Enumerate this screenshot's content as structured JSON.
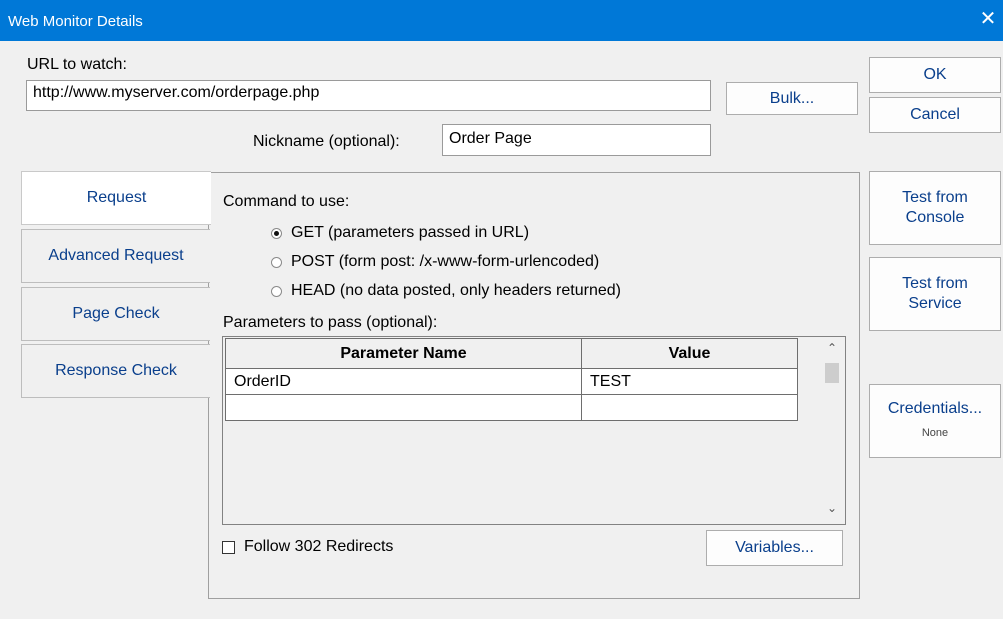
{
  "window": {
    "title": "Web Monitor Details",
    "close_glyph": "✕"
  },
  "url": {
    "label": "URL to watch:",
    "value": "http://www.myserver.com/orderpage.php",
    "bulk_button": "Bulk..."
  },
  "nickname": {
    "label": "Nickname (optional):",
    "value": "Order Page"
  },
  "dialog_buttons": {
    "ok": "OK",
    "cancel": "Cancel"
  },
  "tabs": [
    {
      "label": "Request",
      "active": true
    },
    {
      "label": "Advanced Request",
      "active": false
    },
    {
      "label": "Page Check",
      "active": false
    },
    {
      "label": "Response Check",
      "active": false
    }
  ],
  "request": {
    "command_label": "Command to use:",
    "options": [
      {
        "label": "GET (parameters passed in URL)",
        "selected": true
      },
      {
        "label": "POST (form post: /x-www-form-urlencoded)",
        "selected": false
      },
      {
        "label": "HEAD (no data posted, only headers returned)",
        "selected": false
      }
    ],
    "params_label": "Parameters to pass (optional):",
    "columns": [
      "Parameter Name",
      "Value"
    ],
    "rows": [
      [
        "OrderID",
        "TEST"
      ],
      [
        "",
        ""
      ]
    ],
    "follow_redirects_label": "Follow 302 Redirects",
    "follow_redirects_checked": false,
    "variables_button": "Variables..."
  },
  "side_buttons": {
    "test_console": [
      "Test from",
      "Console"
    ],
    "test_service": [
      "Test from",
      "Service"
    ],
    "credentials": "Credentials...",
    "credentials_status": "None"
  },
  "icons": {
    "scroll_up": "⌃",
    "scroll_down": "⌄"
  }
}
